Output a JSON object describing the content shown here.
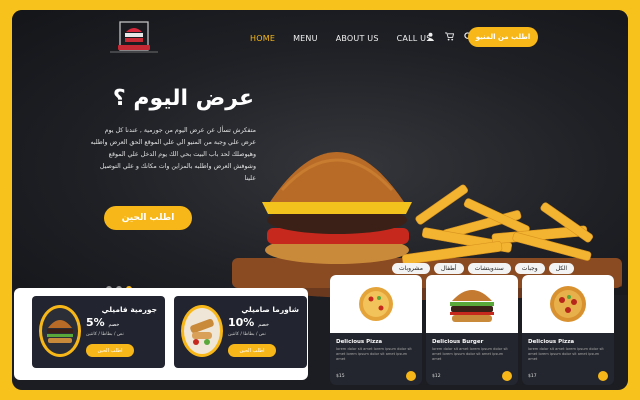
{
  "brand": {
    "logo_alt": "Food logo"
  },
  "nav": {
    "home": "HOME",
    "menu": "MENU",
    "about": "ABOUT US",
    "call": "CALL US"
  },
  "header": {
    "cta": "اطلب من المنيو"
  },
  "hero": {
    "title": "عرض اليوم ؟",
    "text": "متفكرش تسأل عن عرض اليوم من جورمية , عندنا كل يوم عرض علي وجبة من المنيو الي علي الموقع الحق العرض واطلبه وهيوصلك لحد باب البيت بحي الك يوم الدخل علي الموقع وشوفش العرض واطلبه بالمزاين وات مكانك و علي التوصيل علينا",
    "button": "اطلب الحين"
  },
  "tabs": [
    "الكل",
    "وجبات",
    "سندويتشات",
    "أطفال",
    "مشروبات"
  ],
  "offers": [
    {
      "name": "جورمية فاميلي",
      "percent": "5%",
      "unit": "خصم",
      "details": "نص / بطاطا / كانتين",
      "button": "اطلب الحين"
    },
    {
      "name": "شاورما صاميلي",
      "percent": "10%",
      "unit": "خصم",
      "details": "نص / بطاطا / كانتين",
      "button": "اطلب الحين"
    }
  ],
  "products": [
    {
      "title": "Delicious Pizza",
      "desc": "lorem dolor sit amet lorem ipsum dolor sit amet lorem ipsum dolor sit amet ipsum amet",
      "price": "$15"
    },
    {
      "title": "Delicious Burger",
      "desc": "lorem dolor sit amet lorem ipsum dolor sit amet lorem ipsum dolor sit amet ipsum amet",
      "price": "$12"
    },
    {
      "title": "Delicious Pizza",
      "desc": "lorem dolor sit amet lorem ipsum dolor sit amet lorem ipsum dolor sit amet ipsum amet",
      "price": "$17"
    }
  ],
  "colors": {
    "accent": "#f7b718",
    "background": "#1b1d22",
    "frame": "#f7c21b"
  },
  "icons": [
    "user-icon",
    "cart-icon",
    "search-icon"
  ]
}
